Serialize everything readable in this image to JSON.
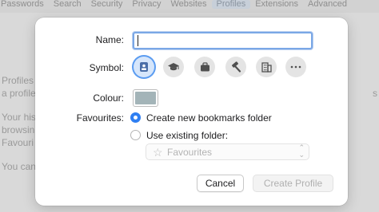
{
  "background": {
    "tabs": [
      "Passwords",
      "Search",
      "Security",
      "Privacy",
      "Websites",
      "Profiles",
      "Extensions",
      "Advanced"
    ],
    "active_tab_index": 5,
    "left_text_lines": [
      "Profiles",
      "a profile t",
      "Your his",
      "browsin",
      "Favouri",
      "You can"
    ],
    "right_text": "s"
  },
  "dialog": {
    "name_label": "Name:",
    "name_value": "",
    "symbol_label": "Symbol:",
    "symbols": [
      "id-badge-icon",
      "graduation-cap-icon",
      "briefcase-icon",
      "hammer-icon",
      "building-icon",
      "more-icon"
    ],
    "selected_symbol_index": 0,
    "colour_label": "Colour:",
    "colour_value": "#a3b4b8",
    "favourites_label": "Favourites:",
    "option_new": "Create new bookmarks folder",
    "option_existing": "Use existing folder:",
    "selected_option": "new",
    "folder_select_value": "Favourites",
    "cancel_label": "Cancel",
    "create_label": "Create Profile"
  }
}
